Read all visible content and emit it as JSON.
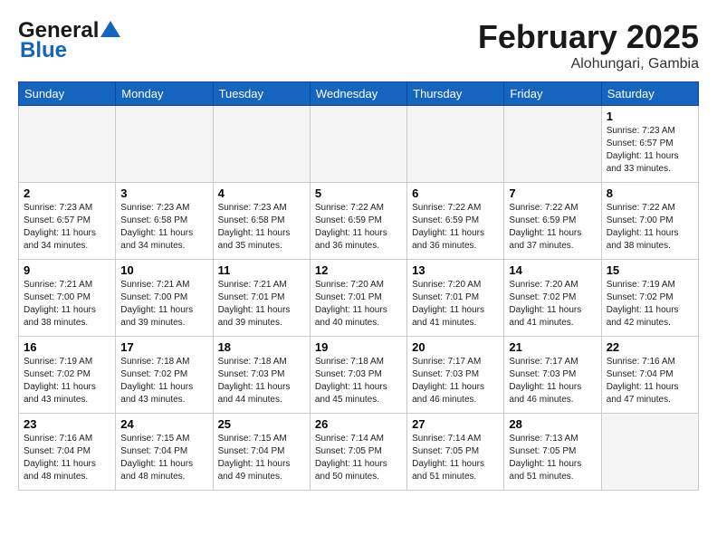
{
  "header": {
    "logo_general": "General",
    "logo_blue": "Blue",
    "month_title": "February 2025",
    "location": "Alohungari, Gambia"
  },
  "calendar": {
    "weekdays": [
      "Sunday",
      "Monday",
      "Tuesday",
      "Wednesday",
      "Thursday",
      "Friday",
      "Saturday"
    ],
    "weeks": [
      [
        {
          "day": "",
          "info": ""
        },
        {
          "day": "",
          "info": ""
        },
        {
          "day": "",
          "info": ""
        },
        {
          "day": "",
          "info": ""
        },
        {
          "day": "",
          "info": ""
        },
        {
          "day": "",
          "info": ""
        },
        {
          "day": "1",
          "info": "Sunrise: 7:23 AM\nSunset: 6:57 PM\nDaylight: 11 hours\nand 33 minutes."
        }
      ],
      [
        {
          "day": "2",
          "info": "Sunrise: 7:23 AM\nSunset: 6:57 PM\nDaylight: 11 hours\nand 34 minutes."
        },
        {
          "day": "3",
          "info": "Sunrise: 7:23 AM\nSunset: 6:58 PM\nDaylight: 11 hours\nand 34 minutes."
        },
        {
          "day": "4",
          "info": "Sunrise: 7:23 AM\nSunset: 6:58 PM\nDaylight: 11 hours\nand 35 minutes."
        },
        {
          "day": "5",
          "info": "Sunrise: 7:22 AM\nSunset: 6:59 PM\nDaylight: 11 hours\nand 36 minutes."
        },
        {
          "day": "6",
          "info": "Sunrise: 7:22 AM\nSunset: 6:59 PM\nDaylight: 11 hours\nand 36 minutes."
        },
        {
          "day": "7",
          "info": "Sunrise: 7:22 AM\nSunset: 6:59 PM\nDaylight: 11 hours\nand 37 minutes."
        },
        {
          "day": "8",
          "info": "Sunrise: 7:22 AM\nSunset: 7:00 PM\nDaylight: 11 hours\nand 38 minutes."
        }
      ],
      [
        {
          "day": "9",
          "info": "Sunrise: 7:21 AM\nSunset: 7:00 PM\nDaylight: 11 hours\nand 38 minutes."
        },
        {
          "day": "10",
          "info": "Sunrise: 7:21 AM\nSunset: 7:00 PM\nDaylight: 11 hours\nand 39 minutes."
        },
        {
          "day": "11",
          "info": "Sunrise: 7:21 AM\nSunset: 7:01 PM\nDaylight: 11 hours\nand 39 minutes."
        },
        {
          "day": "12",
          "info": "Sunrise: 7:20 AM\nSunset: 7:01 PM\nDaylight: 11 hours\nand 40 minutes."
        },
        {
          "day": "13",
          "info": "Sunrise: 7:20 AM\nSunset: 7:01 PM\nDaylight: 11 hours\nand 41 minutes."
        },
        {
          "day": "14",
          "info": "Sunrise: 7:20 AM\nSunset: 7:02 PM\nDaylight: 11 hours\nand 41 minutes."
        },
        {
          "day": "15",
          "info": "Sunrise: 7:19 AM\nSunset: 7:02 PM\nDaylight: 11 hours\nand 42 minutes."
        }
      ],
      [
        {
          "day": "16",
          "info": "Sunrise: 7:19 AM\nSunset: 7:02 PM\nDaylight: 11 hours\nand 43 minutes."
        },
        {
          "day": "17",
          "info": "Sunrise: 7:18 AM\nSunset: 7:02 PM\nDaylight: 11 hours\nand 43 minutes."
        },
        {
          "day": "18",
          "info": "Sunrise: 7:18 AM\nSunset: 7:03 PM\nDaylight: 11 hours\nand 44 minutes."
        },
        {
          "day": "19",
          "info": "Sunrise: 7:18 AM\nSunset: 7:03 PM\nDaylight: 11 hours\nand 45 minutes."
        },
        {
          "day": "20",
          "info": "Sunrise: 7:17 AM\nSunset: 7:03 PM\nDaylight: 11 hours\nand 46 minutes."
        },
        {
          "day": "21",
          "info": "Sunrise: 7:17 AM\nSunset: 7:03 PM\nDaylight: 11 hours\nand 46 minutes."
        },
        {
          "day": "22",
          "info": "Sunrise: 7:16 AM\nSunset: 7:04 PM\nDaylight: 11 hours\nand 47 minutes."
        }
      ],
      [
        {
          "day": "23",
          "info": "Sunrise: 7:16 AM\nSunset: 7:04 PM\nDaylight: 11 hours\nand 48 minutes."
        },
        {
          "day": "24",
          "info": "Sunrise: 7:15 AM\nSunset: 7:04 PM\nDaylight: 11 hours\nand 48 minutes."
        },
        {
          "day": "25",
          "info": "Sunrise: 7:15 AM\nSunset: 7:04 PM\nDaylight: 11 hours\nand 49 minutes."
        },
        {
          "day": "26",
          "info": "Sunrise: 7:14 AM\nSunset: 7:05 PM\nDaylight: 11 hours\nand 50 minutes."
        },
        {
          "day": "27",
          "info": "Sunrise: 7:14 AM\nSunset: 7:05 PM\nDaylight: 11 hours\nand 51 minutes."
        },
        {
          "day": "28",
          "info": "Sunrise: 7:13 AM\nSunset: 7:05 PM\nDaylight: 11 hours\nand 51 minutes."
        },
        {
          "day": "",
          "info": ""
        }
      ]
    ]
  }
}
